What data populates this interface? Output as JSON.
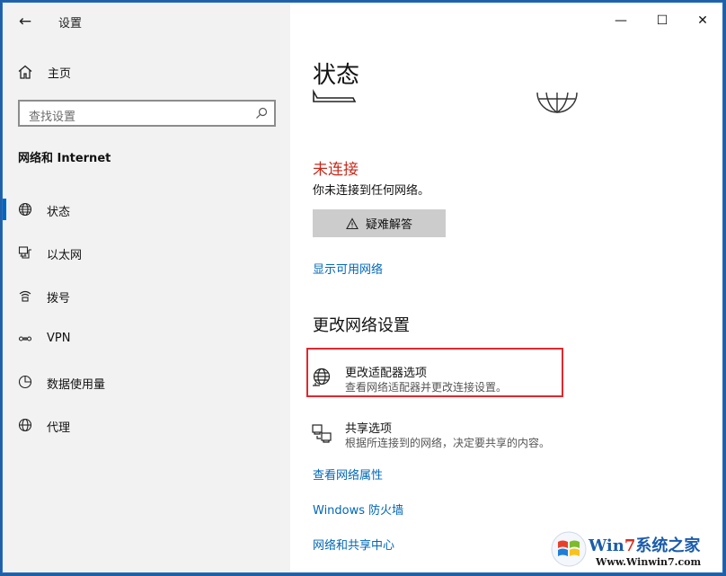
{
  "window": {
    "back_icon": "back-arrow-icon",
    "title": "设置",
    "controls": {
      "minimize": "—",
      "maximize": "☐",
      "close": "✕"
    }
  },
  "sidebar": {
    "home_label": "主页",
    "search_placeholder": "查找设置",
    "section_title": "网络和 Internet",
    "items": [
      {
        "label": "状态",
        "icon": "globe-icon",
        "selected": true
      },
      {
        "label": "以太网",
        "icon": "ethernet-icon",
        "selected": false
      },
      {
        "label": "拨号",
        "icon": "dialup-icon",
        "selected": false
      },
      {
        "label": "VPN",
        "icon": "vpn-icon",
        "selected": false
      },
      {
        "label": "数据使用量",
        "icon": "data-usage-icon",
        "selected": false
      },
      {
        "label": "代理",
        "icon": "proxy-icon",
        "selected": false
      }
    ]
  },
  "main": {
    "title": "状态",
    "connection_status": "未连接",
    "connection_desc": "你未连接到任何网络。",
    "troubleshoot_label": "疑难解答",
    "show_networks_link": "显示可用网络",
    "change_section_title": "更改网络设置",
    "options": [
      {
        "title": "更改适配器选项",
        "desc": "查看网络适配器并更改连接设置。",
        "icon": "adapter-globe-icon",
        "highlighted": true
      },
      {
        "title": "共享选项",
        "desc": "根据所连接到的网络，决定要共享的内容。",
        "icon": "sharing-icon",
        "highlighted": false
      }
    ],
    "links": [
      "查看网络属性",
      "Windows 防火墙",
      "网络和共享中心"
    ]
  },
  "colors": {
    "accent": "#0067c0",
    "link": "#0067b8",
    "error": "#c42b1c",
    "highlight_box": "#e0282e"
  },
  "watermark": {
    "brand_a": "Win",
    "brand_num": "7",
    "brand_b": "系统之家",
    "url": "Www.Winwin7.com"
  }
}
